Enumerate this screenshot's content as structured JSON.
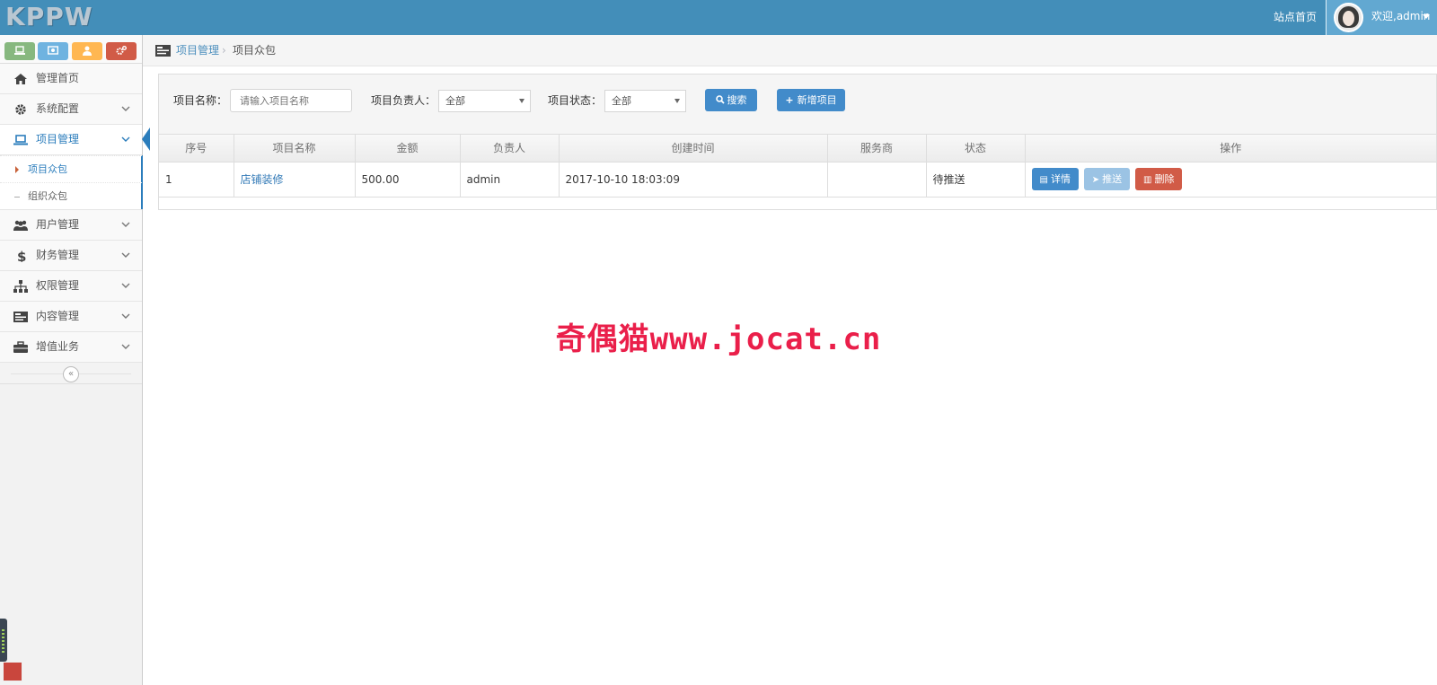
{
  "brand": {
    "logo": "KPPW"
  },
  "navbar": {
    "home_link": "站点首页",
    "user_label": "欢迎,admin"
  },
  "sidebar": {
    "shortcuts": [
      "laptop-icon",
      "picture-icon",
      "user-icon",
      "cogs-icon"
    ],
    "menu": [
      {
        "label": "管理首页",
        "icon": "home-icon"
      },
      {
        "label": "系统配置",
        "icon": "gear-icon"
      },
      {
        "label": "项目管理",
        "icon": "laptop-icon",
        "active": true
      },
      {
        "label": "用户管理",
        "icon": "users-icon"
      },
      {
        "label": "财务管理",
        "icon": "dollar-icon"
      },
      {
        "label": "权限管理",
        "icon": "sitemap-icon"
      },
      {
        "label": "内容管理",
        "icon": "list-icon"
      },
      {
        "label": "增值业务",
        "icon": "briefcase-icon"
      }
    ],
    "submenu": [
      {
        "label": "项目众包",
        "active": true
      },
      {
        "label": "组织众包"
      }
    ],
    "collapse_glyph": "«"
  },
  "breadcrumb": {
    "parent": "项目管理",
    "separator": "›",
    "current": "项目众包"
  },
  "filters": {
    "name_label": "项目名称：",
    "name_placeholder": "请输入项目名称",
    "owner_label": "项目负责人：",
    "owner_value": "全部",
    "status_label": "项目状态：",
    "status_value": "全部",
    "search_button": "搜索",
    "add_button": "新增项目"
  },
  "table": {
    "headers": [
      "序号",
      "项目名称",
      "金额",
      "负责人",
      "创建时间",
      "服务商",
      "状态",
      "操作"
    ],
    "rows": [
      {
        "index": "1",
        "name": "店铺装修",
        "amount": "500.00",
        "owner": "admin",
        "created": "2017-10-10 18:03:09",
        "provider": "",
        "status": "待推送",
        "actions": {
          "detail": "详情",
          "push": "推送",
          "delete": "删除"
        }
      }
    ]
  },
  "watermark": "奇偶猫www.jocat.cn",
  "colors": {
    "navbar": "#438eb9",
    "primary": "#428bca",
    "danger": "#d15b47",
    "watermark": "#ea1f4a"
  }
}
